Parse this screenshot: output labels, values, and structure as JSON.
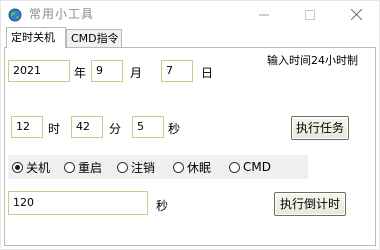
{
  "window": {
    "title": "常用小工具",
    "minimize_glyph": "—",
    "maximize_glyph": "☐",
    "close_glyph": "✕"
  },
  "tabs": [
    {
      "label": "定时关机",
      "active": true
    },
    {
      "label": "CMD指令",
      "active": false
    }
  ],
  "schedule": {
    "hint": "输入时间24小时制",
    "year": "2021",
    "year_unit": "年",
    "month": "9",
    "month_unit": "月",
    "day": "7",
    "day_unit": "日",
    "hour": "12",
    "hour_unit": "时",
    "minute": "42",
    "minute_unit": "分",
    "second": "5",
    "second_unit": "秒",
    "run_button": "执行任务"
  },
  "actions": {
    "options": [
      "关机",
      "重启",
      "注销",
      "休眠",
      "CMD"
    ],
    "selected": "关机"
  },
  "countdown": {
    "value": "120",
    "unit": "秒",
    "button": "执行倒计时"
  }
}
